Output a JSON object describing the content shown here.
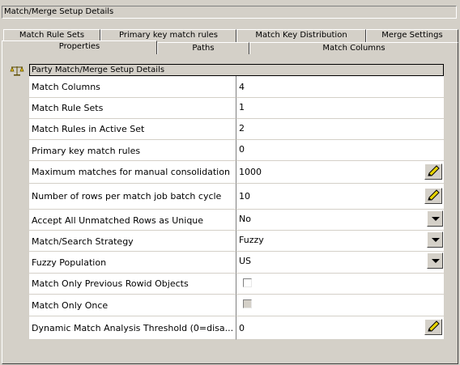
{
  "window": {
    "title": "Match/Merge Setup Details"
  },
  "tabs": {
    "back": [
      "Match Rule Sets",
      "Primary key match rules",
      "Match Key Distribution",
      "Merge Settings"
    ],
    "front": [
      "Properties",
      "Paths",
      "Match Columns"
    ],
    "selected": "Properties"
  },
  "grid": {
    "header": "Party Match/Merge Setup Details",
    "icon": "scale-icon",
    "rows": [
      {
        "label": "Match Columns",
        "value": "4",
        "control": "text"
      },
      {
        "label": "Match Rule Sets",
        "value": "1",
        "control": "text"
      },
      {
        "label": "Match Rules in Active Set",
        "value": "2",
        "control": "text"
      },
      {
        "label": "Primary key match rules",
        "value": "0",
        "control": "text"
      },
      {
        "label": "Maximum matches for manual consolidation",
        "value": "1000",
        "control": "edit",
        "icon": "pencil-icon"
      },
      {
        "label": "Number of rows per match job batch cycle",
        "value": "10",
        "control": "edit",
        "icon": "pencil-icon"
      },
      {
        "label": "Accept All Unmatched Rows as Unique",
        "value": "No",
        "control": "dropdown",
        "icon": "chevron-down-icon"
      },
      {
        "label": "Match/Search Strategy",
        "value": "Fuzzy",
        "control": "dropdown",
        "icon": "chevron-down-icon"
      },
      {
        "label": "Fuzzy Population",
        "value": "US",
        "control": "dropdown",
        "icon": "chevron-down-icon"
      },
      {
        "label": "Match Only Previous Rowid Objects",
        "checked": false,
        "control": "checkbox"
      },
      {
        "label": "Match Only Once",
        "checked": false,
        "disabled": true,
        "control": "checkbox"
      },
      {
        "label": "Dynamic Match Analysis Threshold (0=disa...",
        "value": "0",
        "control": "edit",
        "icon": "pencil-icon"
      }
    ]
  },
  "colors": {
    "face": "#d4d0c8",
    "cell": "#ffffff",
    "pencil_accent": "#e8d400"
  }
}
